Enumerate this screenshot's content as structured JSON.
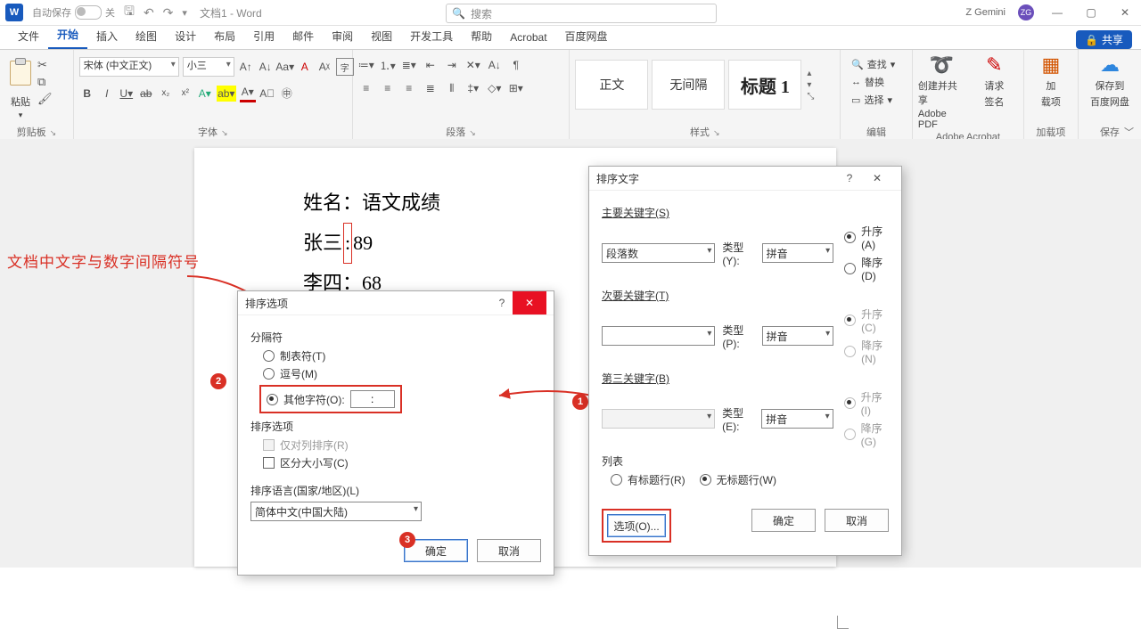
{
  "titlebar": {
    "autosave_label": "自动保存",
    "autosave_state": "关",
    "doc_title": "文档1 - Word",
    "search_placeholder": "搜索",
    "user_name": "Z Gemini",
    "user_initials": "ZG"
  },
  "tabs": {
    "file": "文件",
    "home": "开始",
    "insert": "插入",
    "draw": "绘图",
    "design": "设计",
    "layout": "布局",
    "references": "引用",
    "mailings": "邮件",
    "review": "审阅",
    "view": "视图",
    "dev": "开发工具",
    "help": "帮助",
    "acrobat": "Acrobat",
    "baidu": "百度网盘",
    "share": "共享"
  },
  "ribbon": {
    "clipboard": {
      "paste": "粘贴",
      "label": "剪贴板"
    },
    "font": {
      "name": "宋体 (中文正文)",
      "size": "小三",
      "label": "字体"
    },
    "paragraph": {
      "label": "段落"
    },
    "styles": {
      "normal": "正文",
      "nospacing": "无间隔",
      "heading1": "标题 1",
      "label": "样式"
    },
    "editing": {
      "find": "查找",
      "replace": "替换",
      "select": "选择",
      "label": "编辑"
    },
    "acrobat": {
      "create": "创建并共享",
      "pdf": "Adobe PDF",
      "sign": "请求",
      "sign2": "签名",
      "label": "Adobe Acrobat"
    },
    "addin": {
      "addin1": "加",
      "addin2": "载项",
      "label": "加载项"
    },
    "save": {
      "save1": "保存到",
      "save2": "百度网盘",
      "label": "保存"
    }
  },
  "document": {
    "line1a": "姓名",
    "line1b": "语文成绩",
    "line2a": "张三",
    "line2b": "89",
    "line3a": "李四",
    "line3b": "68",
    "colon": "：",
    "colon_ascii": ":"
  },
  "annotation": {
    "text": "文档中文字与数字间隔符号"
  },
  "dlg_options": {
    "title": "排序选项",
    "sep_label": "分隔符",
    "tab": "制表符(T)",
    "comma": "逗号(M)",
    "other": "其他字符(O):",
    "other_value": ":",
    "opts_label": "排序选项",
    "col_only": "仅对列排序(R)",
    "case": "区分大小写(C)",
    "lang_label": "排序语言(国家/地区)(L)",
    "lang_value": "简体中文(中国大陆)",
    "ok": "确定",
    "cancel": "取消"
  },
  "dlg_sort": {
    "title": "排序文字",
    "key1": "主要关键字(S)",
    "key2": "次要关键字(T)",
    "key3": "第三关键字(B)",
    "field_para": "段落数",
    "type_label1": "类型(Y):",
    "type_label2": "类型(P):",
    "type_label3": "类型(E):",
    "type_pinyin": "拼音",
    "asc1": "升序(A)",
    "desc1": "降序(D)",
    "asc2": "升序(C)",
    "desc2": "降序(N)",
    "asc3": "升序(I)",
    "desc3": "降序(G)",
    "list_label": "列表",
    "header": "有标题行(R)",
    "noheader": "无标题行(W)",
    "options": "选项(O)...",
    "ok": "确定",
    "cancel": "取消"
  }
}
